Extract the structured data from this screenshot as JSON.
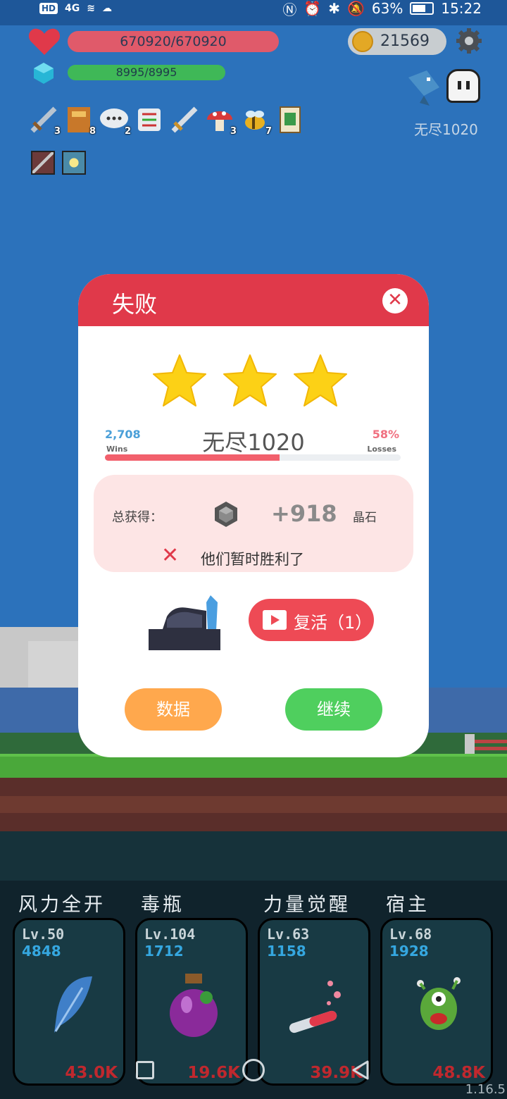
{
  "status_bar": {
    "hd": "HD",
    "signal": "4G",
    "battery": "63%",
    "time": "15:22"
  },
  "hud": {
    "hp": "670920/670920",
    "mp": "8995/8995",
    "coins": "21569",
    "stage_label": "无尽1020",
    "inventory": [
      {
        "icon": "sword-icon",
        "count": "3"
      },
      {
        "icon": "book-icon",
        "count": "8"
      },
      {
        "icon": "chat-bubble-icon",
        "count": "2"
      },
      {
        "icon": "scroll-icon",
        "count": ""
      },
      {
        "icon": "sword-icon",
        "count": ""
      },
      {
        "icon": "mushroom-icon",
        "count": "3"
      },
      {
        "icon": "bee-icon",
        "count": "7"
      },
      {
        "icon": "potion-card-icon",
        "count": ""
      }
    ]
  },
  "dialog": {
    "title": "失败",
    "close": "✕",
    "stars": 3,
    "wins_value": "2,708",
    "wins_label": "Wins",
    "stage_name": "无尽1020",
    "losses_value": "58%",
    "losses_label": "Losses",
    "win_fraction": 0.59,
    "reward_label": "总获得：",
    "reward_value": "+918",
    "reward_unit": "晶石",
    "result_message": "他们暂时胜利了",
    "revive_button": "复活（1）",
    "data_button": "数据",
    "continue_button": "继续"
  },
  "skills": [
    {
      "name": "风力全开",
      "level": "Lv.50",
      "value": "4848",
      "cost": "43.0K",
      "icon": "feather-icon"
    },
    {
      "name": "毒瓶",
      "level": "Lv.104",
      "value": "1712",
      "cost": "19.6K",
      "icon": "poison-bottle-icon"
    },
    {
      "name": "力量觉醒",
      "level": "Lv.63",
      "value": "1158",
      "cost": "39.9K",
      "icon": "test-tube-icon"
    },
    {
      "name": "宿主",
      "level": "Lv.68",
      "value": "1928",
      "cost": "48.8K",
      "icon": "monster-icon"
    }
  ],
  "version": "1.16.5",
  "colors": {
    "header_red": "#e0394a",
    "continue_green": "#4fcf5e",
    "data_orange": "#ffa84d"
  }
}
